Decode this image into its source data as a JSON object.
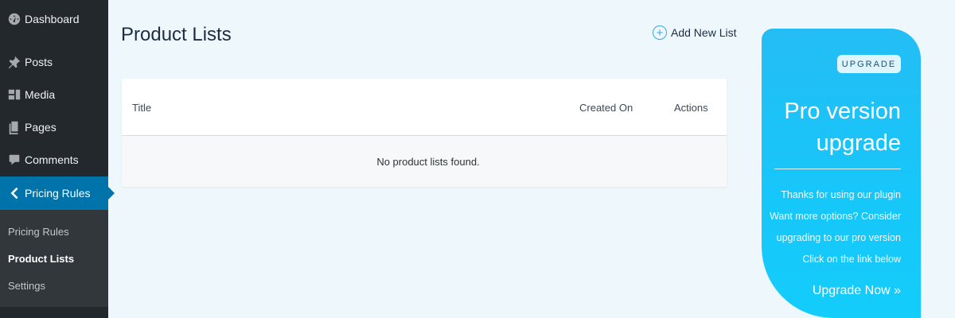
{
  "sidebar": {
    "items": [
      {
        "label": "Dashboard",
        "icon": "dashboard-icon"
      },
      {
        "label": "Posts",
        "icon": "pin-icon"
      },
      {
        "label": "Media",
        "icon": "media-icon"
      },
      {
        "label": "Pages",
        "icon": "page-icon"
      },
      {
        "label": "Comments",
        "icon": "comment-icon"
      },
      {
        "label": "Pricing Rules",
        "icon": "chevron-left-icon"
      }
    ],
    "submenu": [
      "Pricing Rules",
      "Product Lists",
      "Settings"
    ]
  },
  "main": {
    "title": "Product Lists",
    "add_new": "Add New List",
    "table": {
      "columns": [
        "Title",
        "Created On",
        "Actions"
      ],
      "empty_message": "No product lists found."
    }
  },
  "upgrade": {
    "badge": "UPGRADE",
    "title": "Pro version upgrade",
    "lines": [
      "Thanks for using our plugin",
      "Want more options? Consider",
      "upgrading to our pro version",
      "Click on the link below"
    ],
    "link": "Upgrade Now »"
  },
  "colors": {
    "sidebar_bg": "#23282d",
    "active_menu": "#0073aa",
    "page_bg": "#eef8fc",
    "upgrade_gradient": "#24bdf5"
  }
}
